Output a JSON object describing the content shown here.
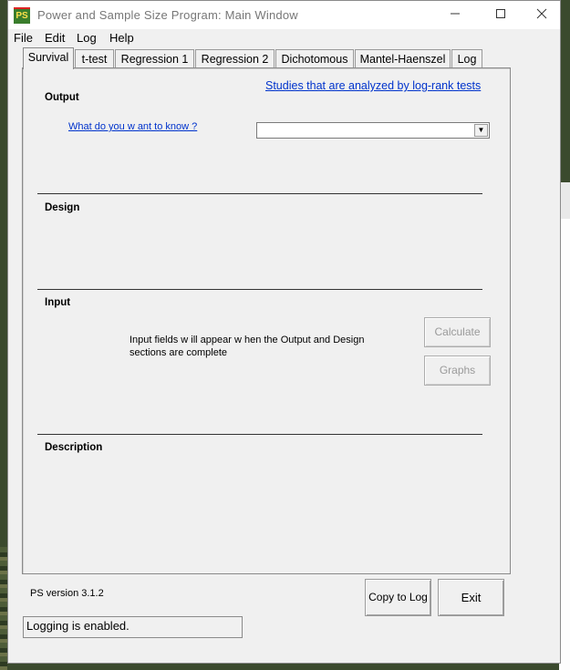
{
  "window": {
    "title": "Power and Sample Size Program:  Main Window",
    "icon_label": "PS"
  },
  "menu": [
    "File",
    "Edit",
    "Log",
    "Help"
  ],
  "tabs": [
    {
      "label": "Survival",
      "active": true
    },
    {
      "label": "t-test",
      "active": false
    },
    {
      "label": "Regression 1",
      "active": false
    },
    {
      "label": "Regression 2",
      "active": false
    },
    {
      "label": "Dichotomous",
      "active": false
    },
    {
      "label": "Mantel-Haenszel",
      "active": false
    },
    {
      "label": "Log",
      "active": false
    }
  ],
  "panel": {
    "header_link": "Studies that are analyzed by log-rank tests",
    "output_label": "Output",
    "what_link": "What do you w ant to know ?",
    "design_label": "Design",
    "input_label": "Input",
    "input_message": "Input fields w ill appear w hen the Output and Design sections are complete",
    "description_label": "Description"
  },
  "buttons": {
    "calculate": "Calculate",
    "graphs": "Graphs",
    "copy_to_log": "Copy to Log",
    "exit": "Exit"
  },
  "version": "PS version 3.1.2",
  "status": "Logging is enabled."
}
